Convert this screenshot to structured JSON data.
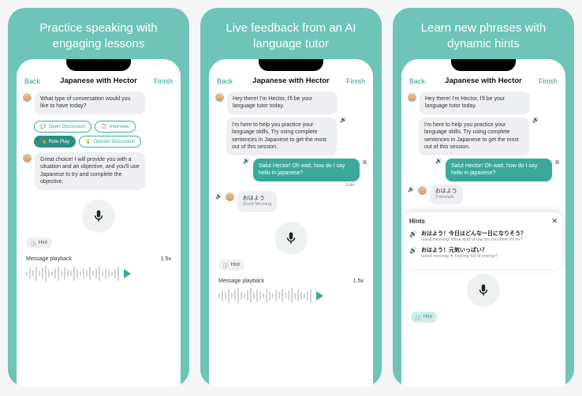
{
  "panels": [
    {
      "headline": "Practice speaking with engaging lessons",
      "nav_back": "Back",
      "nav_title": "Japanese with Hector",
      "nav_finish": "Finish",
      "msg1": "What type of conversation would you like to have today?",
      "chips": {
        "open": "Open Discussion",
        "interview": "Interview",
        "roleplay": "Role Play",
        "opinion": "Opinion Discussion"
      },
      "msg2": "Great choice! I will provide you with a situation and an objective, and you'll use Japanese to try and complete the objective.",
      "hint_label": "Hint",
      "playback_label": "Message playback",
      "playback_speed": "1.5x"
    },
    {
      "headline": "Live feedback from an AI language tutor",
      "nav_back": "Back",
      "nav_title": "Japanese with Hector",
      "nav_finish": "Finish",
      "msg1": "Hey there! I'm Hector, I'll be your language tutor today.",
      "msg2": "I'm here to help you practice your language skills. Try using complete sentences in Japanese to get the most out of this session.",
      "user_msg": "Salut Hector! Oh wait, how do I say hello in japanese?",
      "edit_label": "Edit",
      "jp_reply": "おはよう",
      "jp_reply_sub": "Good Morning",
      "hint_label": "Hint",
      "playback_label": "Message playback",
      "playback_speed": "1.5x"
    },
    {
      "headline": "Learn new phrases with dynamic hints",
      "nav_back": "Back",
      "nav_title": "Japanese with Hector",
      "nav_finish": "Finish",
      "msg1": "Hey there! I'm Hector, I'll be your language tutor today.",
      "msg2": "I'm here to help you practice your language skills. Try using complete sentences in Japanese to get the most out of this session.",
      "user_msg": "Salut Hector! Oh wait, how do I say hello in japanese?",
      "jp_reply": "おはよう",
      "translate_label": "Translate",
      "hints_title": "Hints",
      "hint1_jp": "おはよう！今日はどんな一日になりそう？",
      "hint1_en": "Good morning! What kind of day do you think it'll be?",
      "hint2_jp": "おはよう！元気いっぱい？",
      "hint2_en": "Good morning ☀ Feeling full of energy?",
      "hint_label": "Hint"
    }
  ]
}
